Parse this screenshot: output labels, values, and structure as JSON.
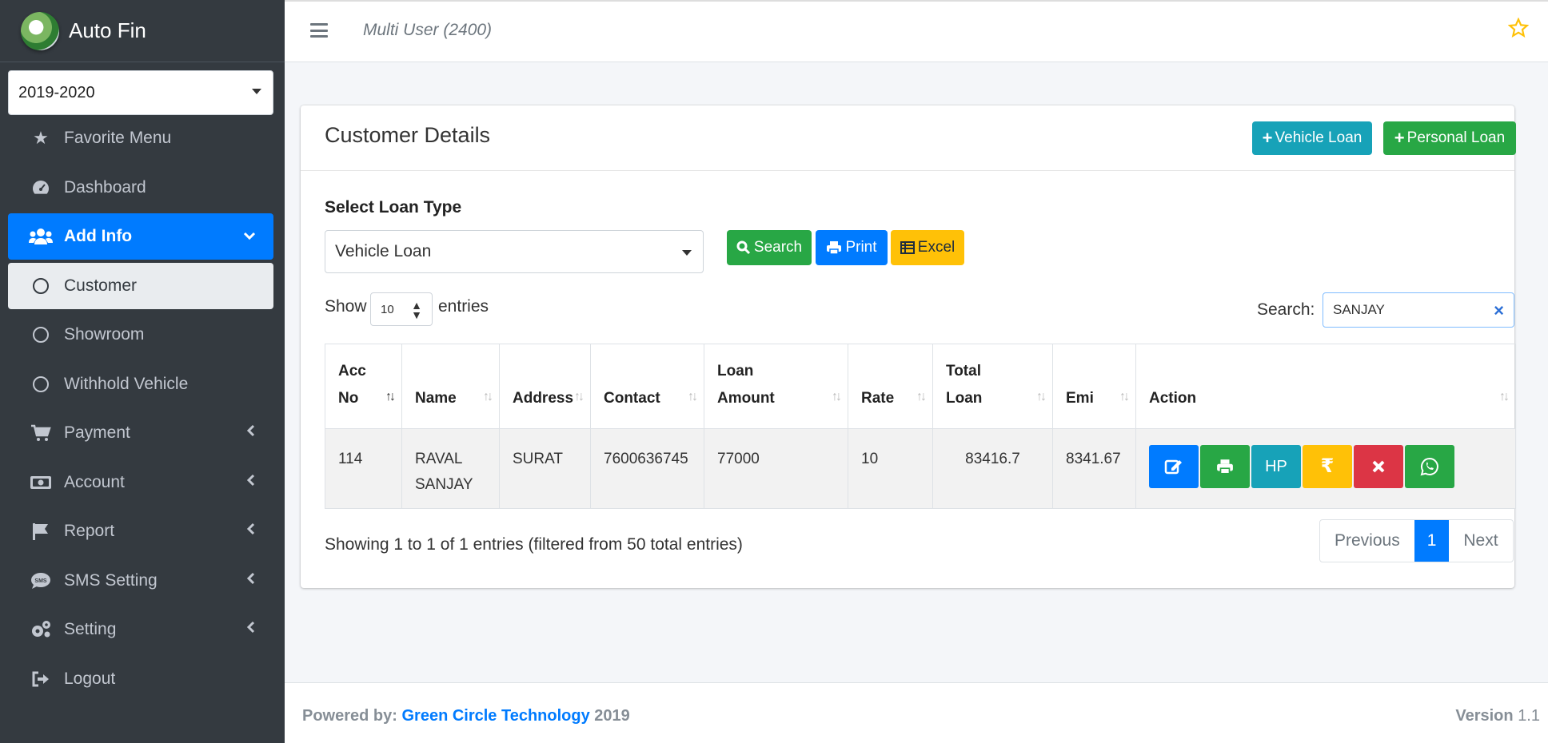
{
  "brand": {
    "name": "Auto Fin"
  },
  "year_select": {
    "value": "2019-2020"
  },
  "sidebar": {
    "items": [
      {
        "label": "Favorite Menu",
        "icon": "star-icon"
      },
      {
        "label": "Dashboard",
        "icon": "tachometer-icon"
      },
      {
        "label": "Add Info",
        "icon": "users-icon",
        "active": true
      },
      {
        "label": "Customer",
        "icon": "circle-icon",
        "selected": true
      },
      {
        "label": "Showroom",
        "icon": "circle-icon"
      },
      {
        "label": "Withhold Vehicle",
        "icon": "circle-icon"
      },
      {
        "label": "Payment",
        "icon": "cart-icon"
      },
      {
        "label": "Account",
        "icon": "money-icon"
      },
      {
        "label": "Report",
        "icon": "flag-icon"
      },
      {
        "label": "SMS Setting",
        "icon": "sms-icon"
      },
      {
        "label": "Setting",
        "icon": "cogs-icon"
      },
      {
        "label": "Logout",
        "icon": "sign-out-icon"
      }
    ]
  },
  "topbar": {
    "user_label": "Multi User (2400)"
  },
  "card": {
    "title": "Customer Details",
    "vehicle_loan_btn": "Vehicle Loan",
    "personal_loan_btn": "Personal Loan",
    "loan_type_label": "Select Loan Type",
    "loan_type_value": "Vehicle Loan",
    "search_btn": "Search",
    "print_btn": "Print",
    "excel_btn": "Excel",
    "show_label": "Show",
    "entries_value": "10",
    "entries_label": "entries",
    "search_label": "Search:",
    "search_value": "SANJAY"
  },
  "table": {
    "headers": {
      "acc_no_1": "Acc",
      "acc_no_2": "No",
      "name": "Name",
      "address": "Address",
      "contact": "Contact",
      "loan_amount_1": "Loan",
      "loan_amount_2": "Amount",
      "rate": "Rate",
      "total_loan_1": "Total",
      "total_loan_2": "Loan",
      "emi": "Emi",
      "action": "Action"
    },
    "rows": [
      {
        "acc_no": "114",
        "name_1": "RAVAL",
        "name_2": "SANJAY",
        "address": "SURAT",
        "contact": "7600636745",
        "loan_amount": "77000",
        "rate": "10",
        "total_loan": "83416.7",
        "emi": "8341.67",
        "hp_label": "HP",
        "rupee": "₹"
      }
    ]
  },
  "pagination": {
    "info": "Showing 1 to 1 of 1 entries (filtered from 50 total entries)",
    "previous": "Previous",
    "current": "1",
    "next": "Next"
  },
  "footer": {
    "powered_prefix": "Powered by:",
    "company": "Green Circle Technology",
    "year": "2019",
    "version_label": "Version",
    "version_value": "1.1"
  },
  "colors": {
    "sidebar_bg": "#343a40",
    "primary": "#007bff",
    "info": "#17a2b8",
    "success": "#28a745",
    "warning": "#ffc107",
    "danger": "#dc3545"
  }
}
